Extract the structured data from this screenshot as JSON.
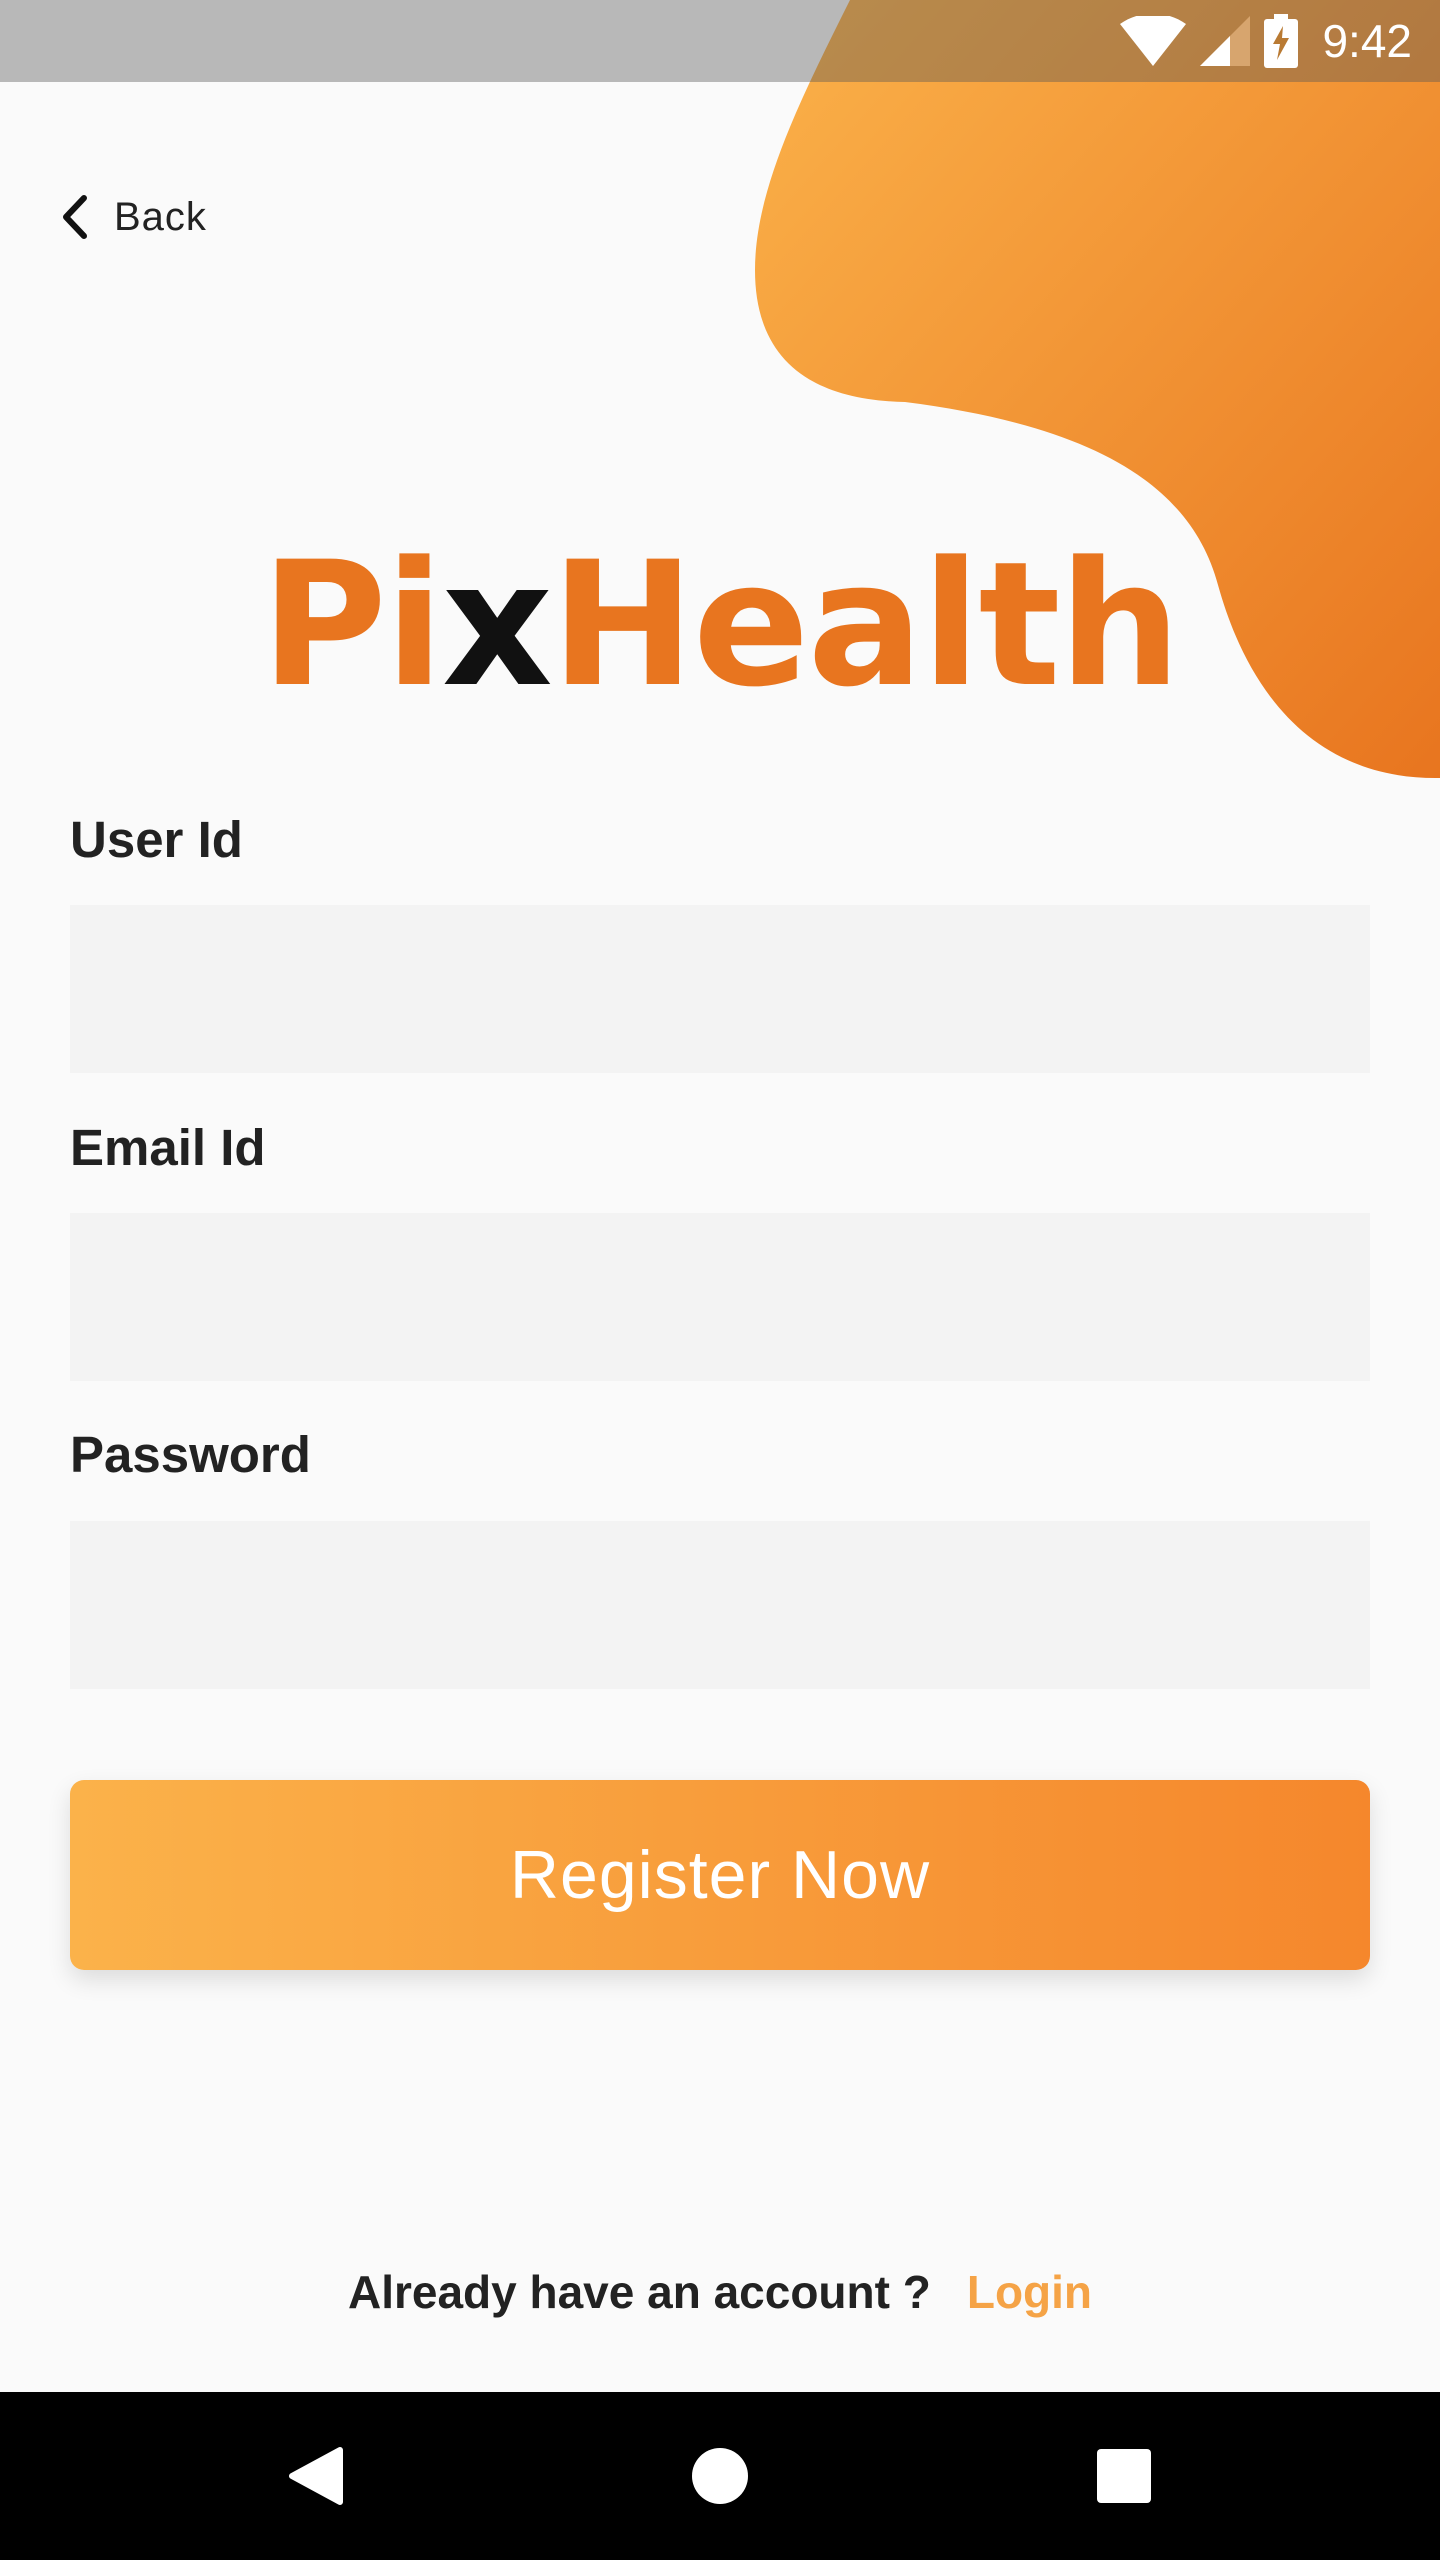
{
  "status_bar": {
    "time": "9:42",
    "icons": [
      "wifi-icon",
      "signal-icon",
      "battery-charging-icon"
    ]
  },
  "back": {
    "label": "Back",
    "icon": "chevron-left-icon"
  },
  "logo": {
    "part1": "Pi",
    "part2": "x",
    "part3": "Health"
  },
  "form": {
    "user_id": {
      "label": "User Id",
      "value": ""
    },
    "email_id": {
      "label": "Email Id",
      "value": ""
    },
    "password": {
      "label": "Password",
      "value": ""
    }
  },
  "register_button": {
    "label": "Register Now"
  },
  "footer": {
    "prompt": "Already have an account ?",
    "login_label": "Login"
  },
  "nav_bar": {
    "icons": [
      "back-triangle-icon",
      "home-circle-icon",
      "recents-square-icon"
    ]
  },
  "colors": {
    "accent_orange": "#e8751f",
    "gradient_start": "#fbb24a",
    "gradient_end": "#f5872c",
    "login_link": "#f5a346",
    "input_bg": "#f3f3f3"
  }
}
